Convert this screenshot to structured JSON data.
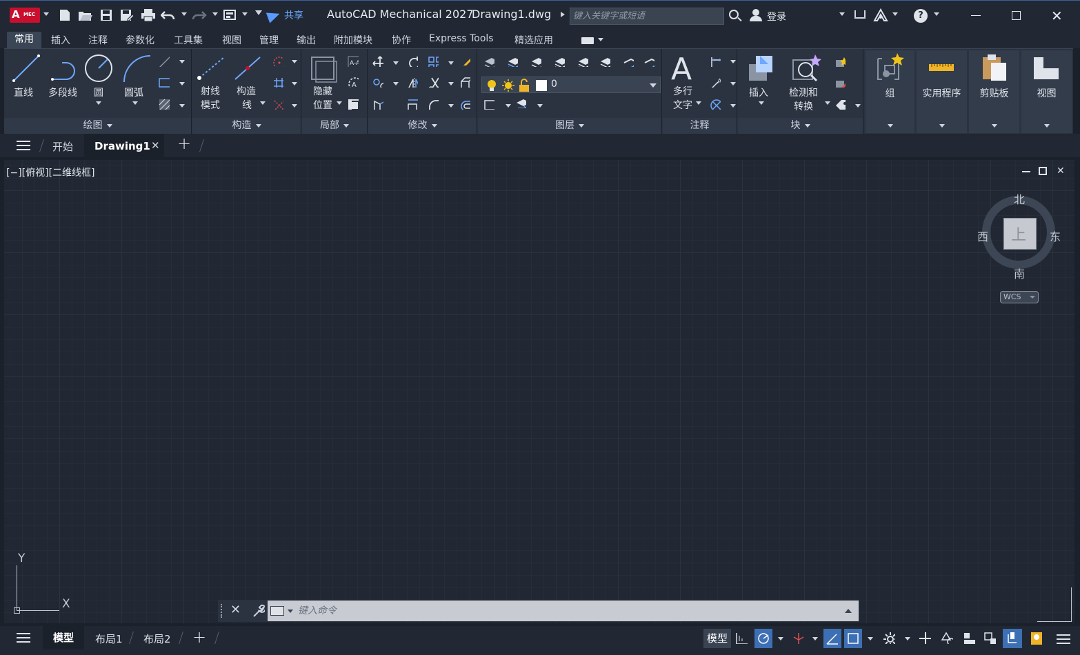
{
  "titlebar": {
    "app_badge": "A",
    "app_badge_sub": "MEC",
    "share_label": "共享",
    "app_title": "AutoCAD Mechanical 2027",
    "doc_title": "Drawing1.dwg",
    "search_placeholder": "键入关键字或短语",
    "login_label": "登录",
    "help_label": "?"
  },
  "ribbon_tabs": [
    "常用",
    "插入",
    "注释",
    "参数化",
    "工具集",
    "视图",
    "管理",
    "输出",
    "附加模块",
    "协作",
    "Express Tools",
    "精选应用"
  ],
  "ribbon": {
    "draw": {
      "title": "绘图",
      "tools": [
        "直线",
        "多段线",
        "圆",
        "圆弧"
      ]
    },
    "construct": {
      "title": "构造",
      "tools": [
        "射线",
        "模式",
        "构造",
        "线"
      ]
    },
    "detail": {
      "title": "局部",
      "tools": [
        "隐藏",
        "位置"
      ]
    },
    "modify": {
      "title": "修改"
    },
    "layers": {
      "title": "图层",
      "current_layer": "0"
    },
    "annotation": {
      "title": "注释",
      "tools": [
        "多行",
        "文字"
      ]
    },
    "block": {
      "title": "块",
      "tools": [
        "插入",
        "检测和",
        "转换"
      ]
    },
    "group": "组",
    "utilities": "实用程序",
    "clipboard": "剪贴板",
    "view": "视图"
  },
  "doc_tabs": {
    "start": "开始",
    "active": "Drawing1",
    "close": "✕",
    "add": "+"
  },
  "viewport": {
    "label": "[−][俯视][二维线框]",
    "compass": {
      "north": "北",
      "south": "南",
      "east": "东",
      "west": "西",
      "face": "上"
    },
    "wcs": "WCS",
    "ucs_x": "X",
    "ucs_y": "Y"
  },
  "cmdline": {
    "placeholder": "键入命令"
  },
  "statusbar": {
    "layouts": [
      "模型",
      "布局1",
      "布局2"
    ],
    "model_label": "模型"
  },
  "colors": {
    "accent": "#3d6fb4",
    "background": "#212833",
    "brand": "#c8102e"
  }
}
